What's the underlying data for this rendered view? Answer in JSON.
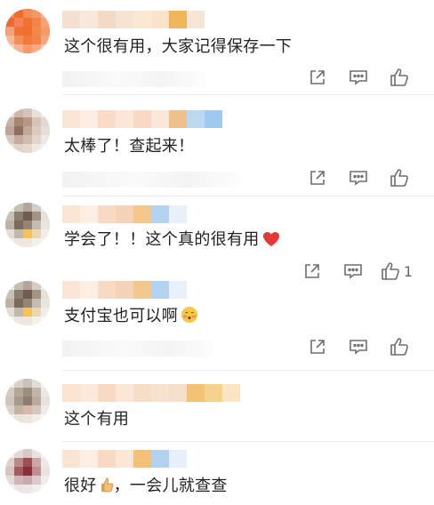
{
  "comments": [
    {
      "text": "这个很有用，大家记得保存一下",
      "like_count": ""
    },
    {
      "text": "太棒了！查起来！",
      "like_count": ""
    },
    {
      "text": "学会了！！这个真的很有用",
      "like_count": "1",
      "emoji": "red-heart-icon"
    },
    {
      "text": "支付宝也可以啊",
      "like_count": "",
      "emoji": "blushing-face-icon"
    },
    {
      "text": "这个有用",
      "like_count": ""
    },
    {
      "text": "很好",
      "suffix": "，一会儿就查查",
      "like_count": "",
      "emoji": "thumbs-up-icon"
    }
  ],
  "colors": {
    "icon": "#6e6e6e",
    "heart": "#e53935",
    "text": "#222222",
    "divider": "#ececec"
  }
}
